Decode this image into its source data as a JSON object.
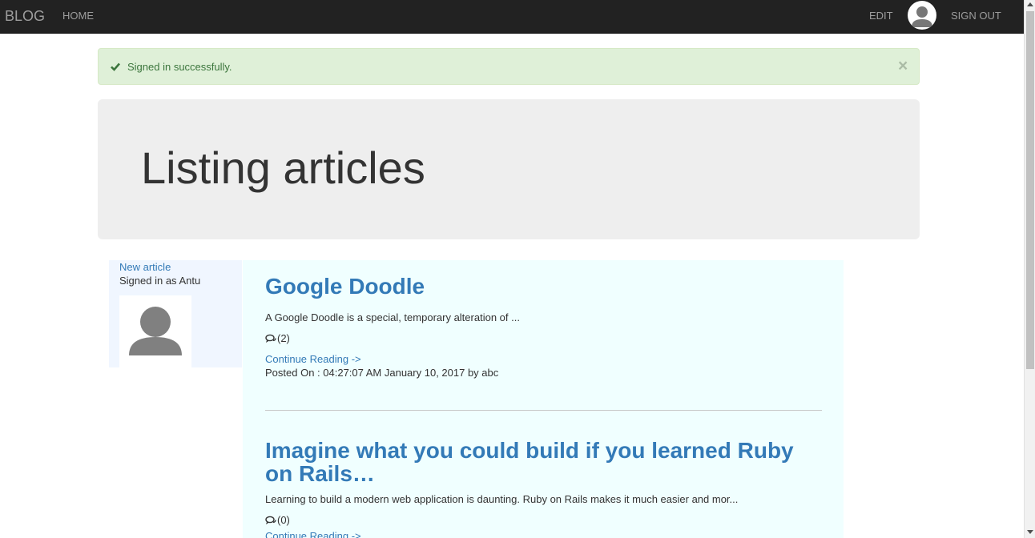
{
  "navbar": {
    "brand": "BLOG",
    "home": "HOME",
    "edit": "EDIT",
    "sign_out": "SIGN OUT"
  },
  "alert": {
    "message": "Signed in successfully.",
    "close": "×"
  },
  "jumbotron": {
    "title": "Listing articles"
  },
  "sidebar": {
    "new_article": "New article",
    "signed_in_as": "Signed in as Antu"
  },
  "articles": [
    {
      "title": "Google Doodle",
      "excerpt": "A Google Doodle is a special, temporary alteration of ...",
      "comments": "(2)",
      "continue": "Continue Reading ->",
      "posted": "Posted On : 04:27:07 AM January 10, 2017 by abc"
    },
    {
      "title": "Imagine what you could build if you learned Ruby on Rails…",
      "excerpt": "Learning to build a modern web application is daunting. Ruby on Rails makes it much easier and mor...",
      "comments": "(0)",
      "continue": "Continue Reading ->"
    }
  ],
  "colors": {
    "navbar_bg": "#222222",
    "link": "#337ab7",
    "alert_bg": "#dff0d8",
    "alert_text": "#3c763d",
    "jumbotron_bg": "#eeeeee",
    "sidebar_bg": "#f0f6ff",
    "main_bg": "#f0ffff"
  }
}
